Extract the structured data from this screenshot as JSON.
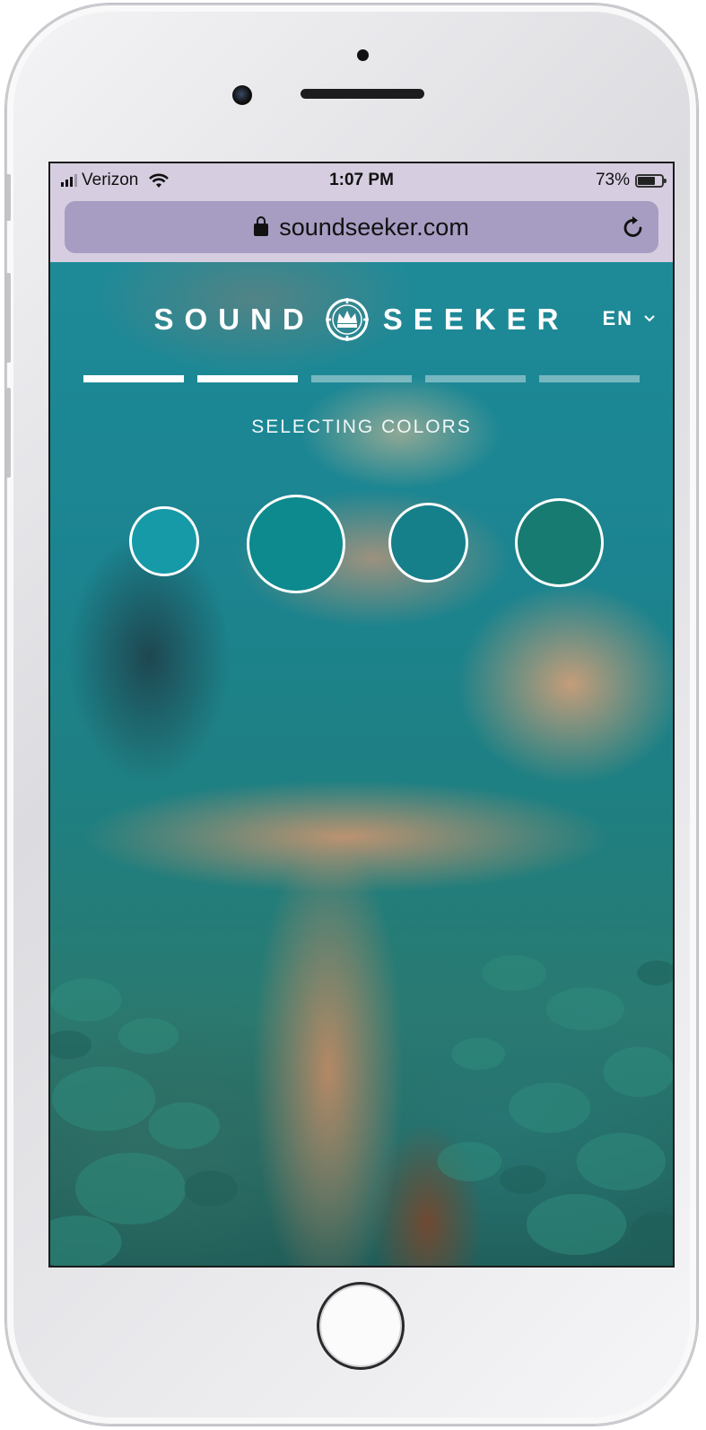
{
  "status_bar": {
    "carrier": "Verizon",
    "time": "1:07 PM",
    "battery": "73%",
    "battery_level": 0.73
  },
  "browser": {
    "url": "soundseeker.com"
  },
  "site": {
    "logo_left": "SOUND",
    "logo_right": "SEEKER",
    "language": "EN",
    "progress": {
      "total_steps": 5,
      "completed_steps": 2
    },
    "step_title": "SELECTING COLORS",
    "swatches": [
      {
        "name": "color-swatch-1",
        "color": "#169aa8"
      },
      {
        "name": "color-swatch-2",
        "color": "#0c8a8e"
      },
      {
        "name": "color-swatch-3",
        "color": "#157f8a"
      },
      {
        "name": "color-swatch-4",
        "color": "#177b72"
      }
    ]
  },
  "icons": [
    "signal-icon",
    "wifi-icon",
    "battery-icon",
    "lock-icon",
    "reload-icon",
    "crown-icon",
    "chevron-down-icon",
    "home-button"
  ]
}
